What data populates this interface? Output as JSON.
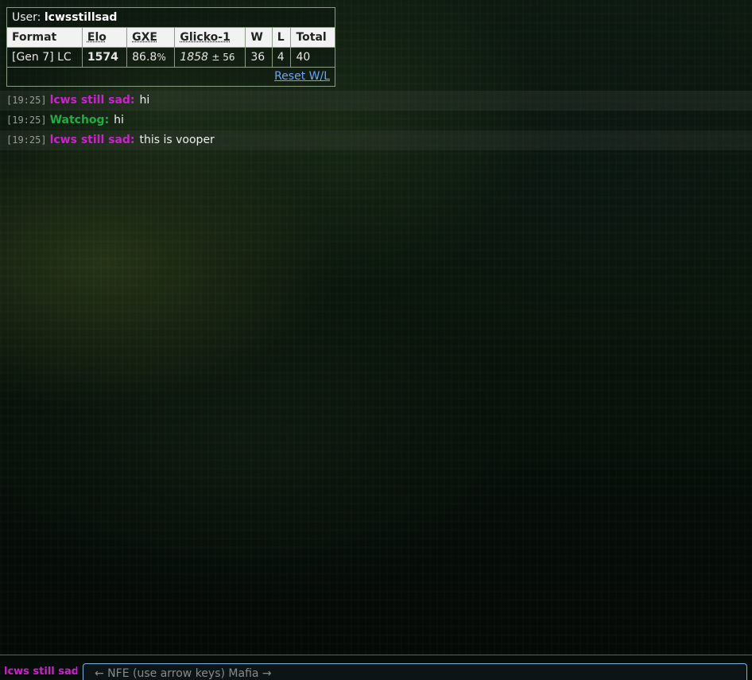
{
  "ratings": {
    "user_label": "User: ",
    "username": "lcwsstillsad",
    "headers": [
      "Format",
      "Elo",
      "GXE",
      "Glicko-1",
      "W",
      "L",
      "Total"
    ],
    "row": {
      "format": "[Gen 7] LC",
      "elo": "1574",
      "gxe_main": "86.8",
      "gxe_suffix": "%",
      "glicko_value": "1858",
      "glicko_dev": "± 56",
      "w": "36",
      "l": "4",
      "total": "40"
    },
    "reset_label": "Reset W/L"
  },
  "chat": {
    "messages": [
      {
        "time": "[19:25]",
        "author": "lcws still sad:",
        "text": "hi",
        "color": "#cc22cc"
      },
      {
        "time": "[19:25]",
        "author": "Watchog:",
        "text": "hi",
        "color": "#22aa44"
      },
      {
        "time": "[19:25]",
        "author": "lcws still sad:",
        "text": "this is vooper",
        "color": "#cc22cc"
      }
    ]
  },
  "input": {
    "current_user": "lcws still sad",
    "placeholder": "← NFE (use arrow keys) Mafia →",
    "user_color": "#cc22cc"
  }
}
